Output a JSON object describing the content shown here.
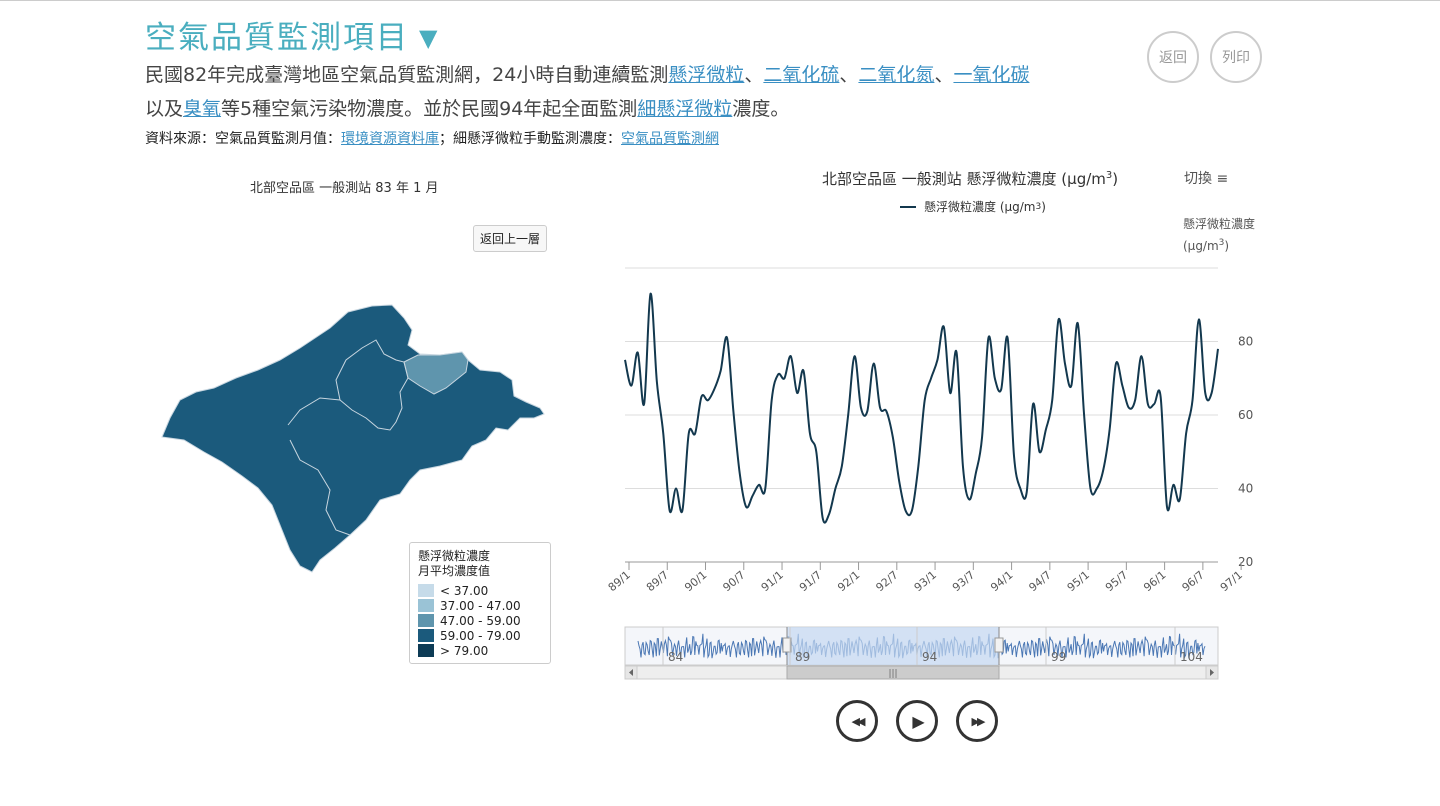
{
  "header": {
    "title": "空氣品質監測項目",
    "title_arrow": "▼",
    "desc_part1": "民國82年完成臺灣地區空氣品質監測網，24小時自動連續監測",
    "link_pm10": "懸浮微粒",
    "sep": "、",
    "link_so2": "二氧化硫",
    "link_no2": "二氧化氮",
    "link_co": "一氧化碳",
    "desc_part2": "以及",
    "link_o3": "臭氧",
    "desc_part3": "等5種空氣污染物濃度。並於民國94年起全面監測",
    "link_pm25": "細懸浮微粒",
    "desc_part4": "濃度。",
    "source_prefix": "資料來源：空氣品質監測月值：",
    "source_link1": "環境資源資料庫",
    "source_mid": "；細懸浮微粒手動監測濃度：",
    "source_link2": "空氣品質監測網"
  },
  "buttons": {
    "back": "返回",
    "print": "列印",
    "map_back": "返回上一層",
    "switch": "切換 ≡"
  },
  "map": {
    "title": "北部空品區 一般測站 83 年 1 月",
    "legend_title1": "懸浮微粒濃度",
    "legend_title2": "月平均濃度值",
    "legend": [
      {
        "label": "< 37.00",
        "color": "#c6dbe9"
      },
      {
        "label": "37.00 - 47.00",
        "color": "#9ac3d6"
      },
      {
        "label": "47.00 - 59.00",
        "color": "#5f95ad"
      },
      {
        "label": "59.00 - 79.00",
        "color": "#1b5a7c"
      },
      {
        "label": "> 79.00",
        "color": "#0d3b55"
      }
    ],
    "main_color": "#1b5a7c",
    "highlight_color": "#5f95ad"
  },
  "chart_data": {
    "type": "line",
    "title": "北部空品區 一般測站 懸浮微粒濃度 (μg/m",
    "title_sup": "3",
    "title_end": ")",
    "legend_label": "懸浮微粒濃度 (μg/m",
    "ylabel_line1": "懸浮微粒濃度",
    "ylabel_line2": "(μg/m",
    "ylim": [
      20,
      100
    ],
    "yticks": [
      20,
      40,
      60,
      80
    ],
    "xticks": [
      "89/1",
      "89/7",
      "90/1",
      "90/7",
      "91/1",
      "91/7",
      "92/1",
      "92/7",
      "93/1",
      "93/7",
      "94/1",
      "94/7",
      "95/1",
      "95/7",
      "96/1",
      "96/7",
      "97/1"
    ],
    "series_color": "#13384e",
    "series": [
      {
        "name": "懸浮微粒濃度",
        "start": "89/1",
        "values": [
          75,
          68,
          77,
          63,
          93,
          69,
          55,
          34,
          40,
          34,
          55,
          55,
          65,
          64,
          67,
          72,
          81,
          61,
          44,
          35,
          38,
          41,
          40,
          64,
          71,
          70,
          76,
          66,
          72,
          55,
          50,
          32,
          33,
          40,
          46,
          60,
          76,
          62,
          61,
          74,
          62,
          61,
          54,
          42,
          34,
          34,
          46,
          64,
          70,
          75,
          84,
          66,
          77,
          46,
          37,
          44,
          54,
          81,
          70,
          67,
          81,
          49,
          40,
          39,
          63,
          50,
          56,
          64,
          86,
          74,
          68,
          85,
          60,
          40,
          40,
          45,
          56,
          74,
          68,
          62,
          64,
          76,
          63,
          63,
          65,
          35,
          41,
          37,
          55,
          64,
          86,
          66,
          66,
          78
        ]
      }
    ],
    "navigator": {
      "labels": [
        "84",
        "89",
        "94",
        "99",
        "104"
      ],
      "selection_color": "#c5d9f1"
    }
  },
  "playback": {
    "rewind_icon": "◀◀",
    "play_icon": "▶",
    "forward_icon": "▶▶"
  }
}
